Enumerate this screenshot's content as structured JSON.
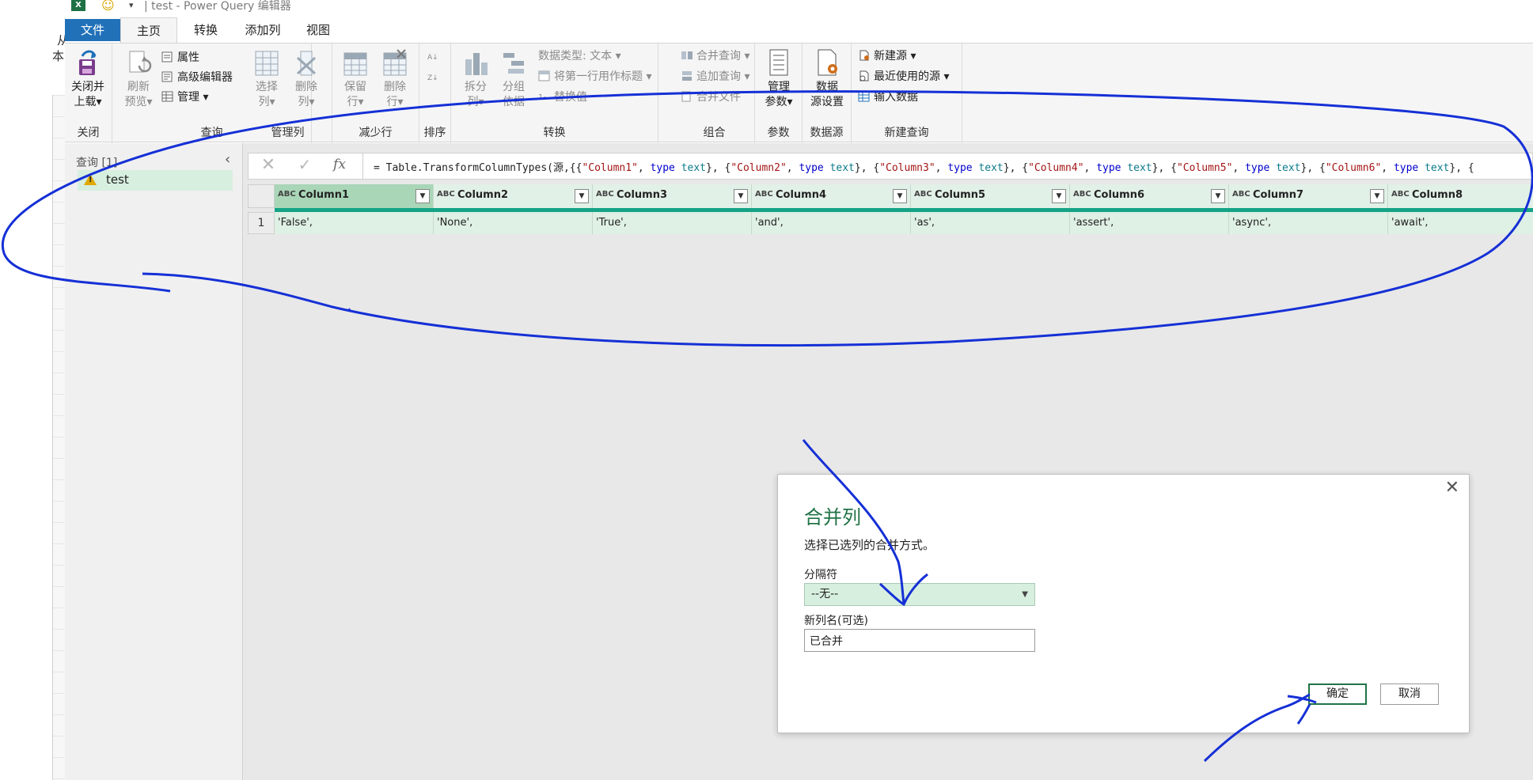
{
  "window": {
    "title": "| test - Power Query 编辑器",
    "left_char_1": "从",
    "left_char_2": "本"
  },
  "tabs": {
    "file": "文件",
    "home": "主页",
    "transform": "转换",
    "add_column": "添加列",
    "view": "视图"
  },
  "ribbon": {
    "close": {
      "close_load_line1": "关闭并",
      "close_load_line2": "上载",
      "label": "关闭"
    },
    "query": {
      "refresh_line1": "刷新",
      "refresh_line2": "预览",
      "properties": "属性",
      "advanced_editor": "高级编辑器",
      "manage": "管理",
      "label": "查询"
    },
    "manage_columns": {
      "choose_line1": "选择",
      "choose_line2": "列",
      "remove_line1": "删除",
      "remove_line2": "列",
      "label": "管理列"
    },
    "reduce_rows": {
      "keep_line1": "保留",
      "keep_line2": "行",
      "remove_line1": "删除",
      "remove_line2": "行",
      "label": "减少行"
    },
    "sort": {
      "label": "排序"
    },
    "transform": {
      "split_line1": "拆分",
      "split_line2": "列",
      "group_line1": "分组",
      "group_line2": "依据",
      "data_type": "数据类型: 文本",
      "first_row_headers": "将第一行用作标题",
      "replace_values": "替换值",
      "label": "转换"
    },
    "combine": {
      "merge_queries": "合并查询",
      "append_queries": "追加查询",
      "combine_files": "合并文件",
      "label": "组合"
    },
    "parameters": {
      "manage_line1": "管理",
      "manage_line2": "参数",
      "label": "参数"
    },
    "data_sources": {
      "settings_line1": "数据",
      "settings_line2": "源设置",
      "label": "数据源"
    },
    "new_query": {
      "new_source": "新建源",
      "recent_sources": "最近使用的源",
      "enter_data": "输入数据",
      "label": "新建查询"
    }
  },
  "query_pane": {
    "header": "查询 [1]",
    "items": [
      {
        "name": "test"
      }
    ]
  },
  "formula": {
    "prefix": "= Table.TransformColumnTypes(源,{{",
    "parts": [
      {
        "col": "\"Column1\"",
        "type": "type",
        "t": "text"
      },
      {
        "col": "\"Column2\"",
        "type": "type",
        "t": "text"
      },
      {
        "col": "\"Column3\"",
        "type": "type",
        "t": "text"
      },
      {
        "col": "\"Column4\"",
        "type": "type",
        "t": "text"
      },
      {
        "col": "\"Column5\"",
        "type": "type",
        "t": "text"
      },
      {
        "col": "\"Column6\"",
        "type": "type",
        "t": "text"
      }
    ]
  },
  "grid": {
    "columns": [
      {
        "name": "Column1",
        "type": "ABC"
      },
      {
        "name": "Column2",
        "type": "ABC"
      },
      {
        "name": "Column3",
        "type": "ABC"
      },
      {
        "name": "Column4",
        "type": "ABC"
      },
      {
        "name": "Column5",
        "type": "ABC"
      },
      {
        "name": "Column6",
        "type": "ABC"
      },
      {
        "name": "Column7",
        "type": "ABC"
      },
      {
        "name": "Column8",
        "type": "ABC"
      }
    ],
    "rows": [
      {
        "num": "1",
        "cells": [
          "'False',",
          "'None',",
          "'True',",
          "'and',",
          "'as',",
          "'assert',",
          "'async',",
          "'await',"
        ]
      }
    ]
  },
  "dialog": {
    "title": "合并列",
    "description": "选择已选列的合并方式。",
    "separator_label": "分隔符",
    "separator_value": "--无--",
    "new_name_label": "新列名(可选)",
    "new_name_value": "已合并",
    "ok": "确定",
    "cancel": "取消"
  },
  "colors": {
    "accent_green": "#217346",
    "file_tab_blue": "#2171b9",
    "annotation_blue": "#1530d6",
    "quality_bar": "#15a386"
  }
}
